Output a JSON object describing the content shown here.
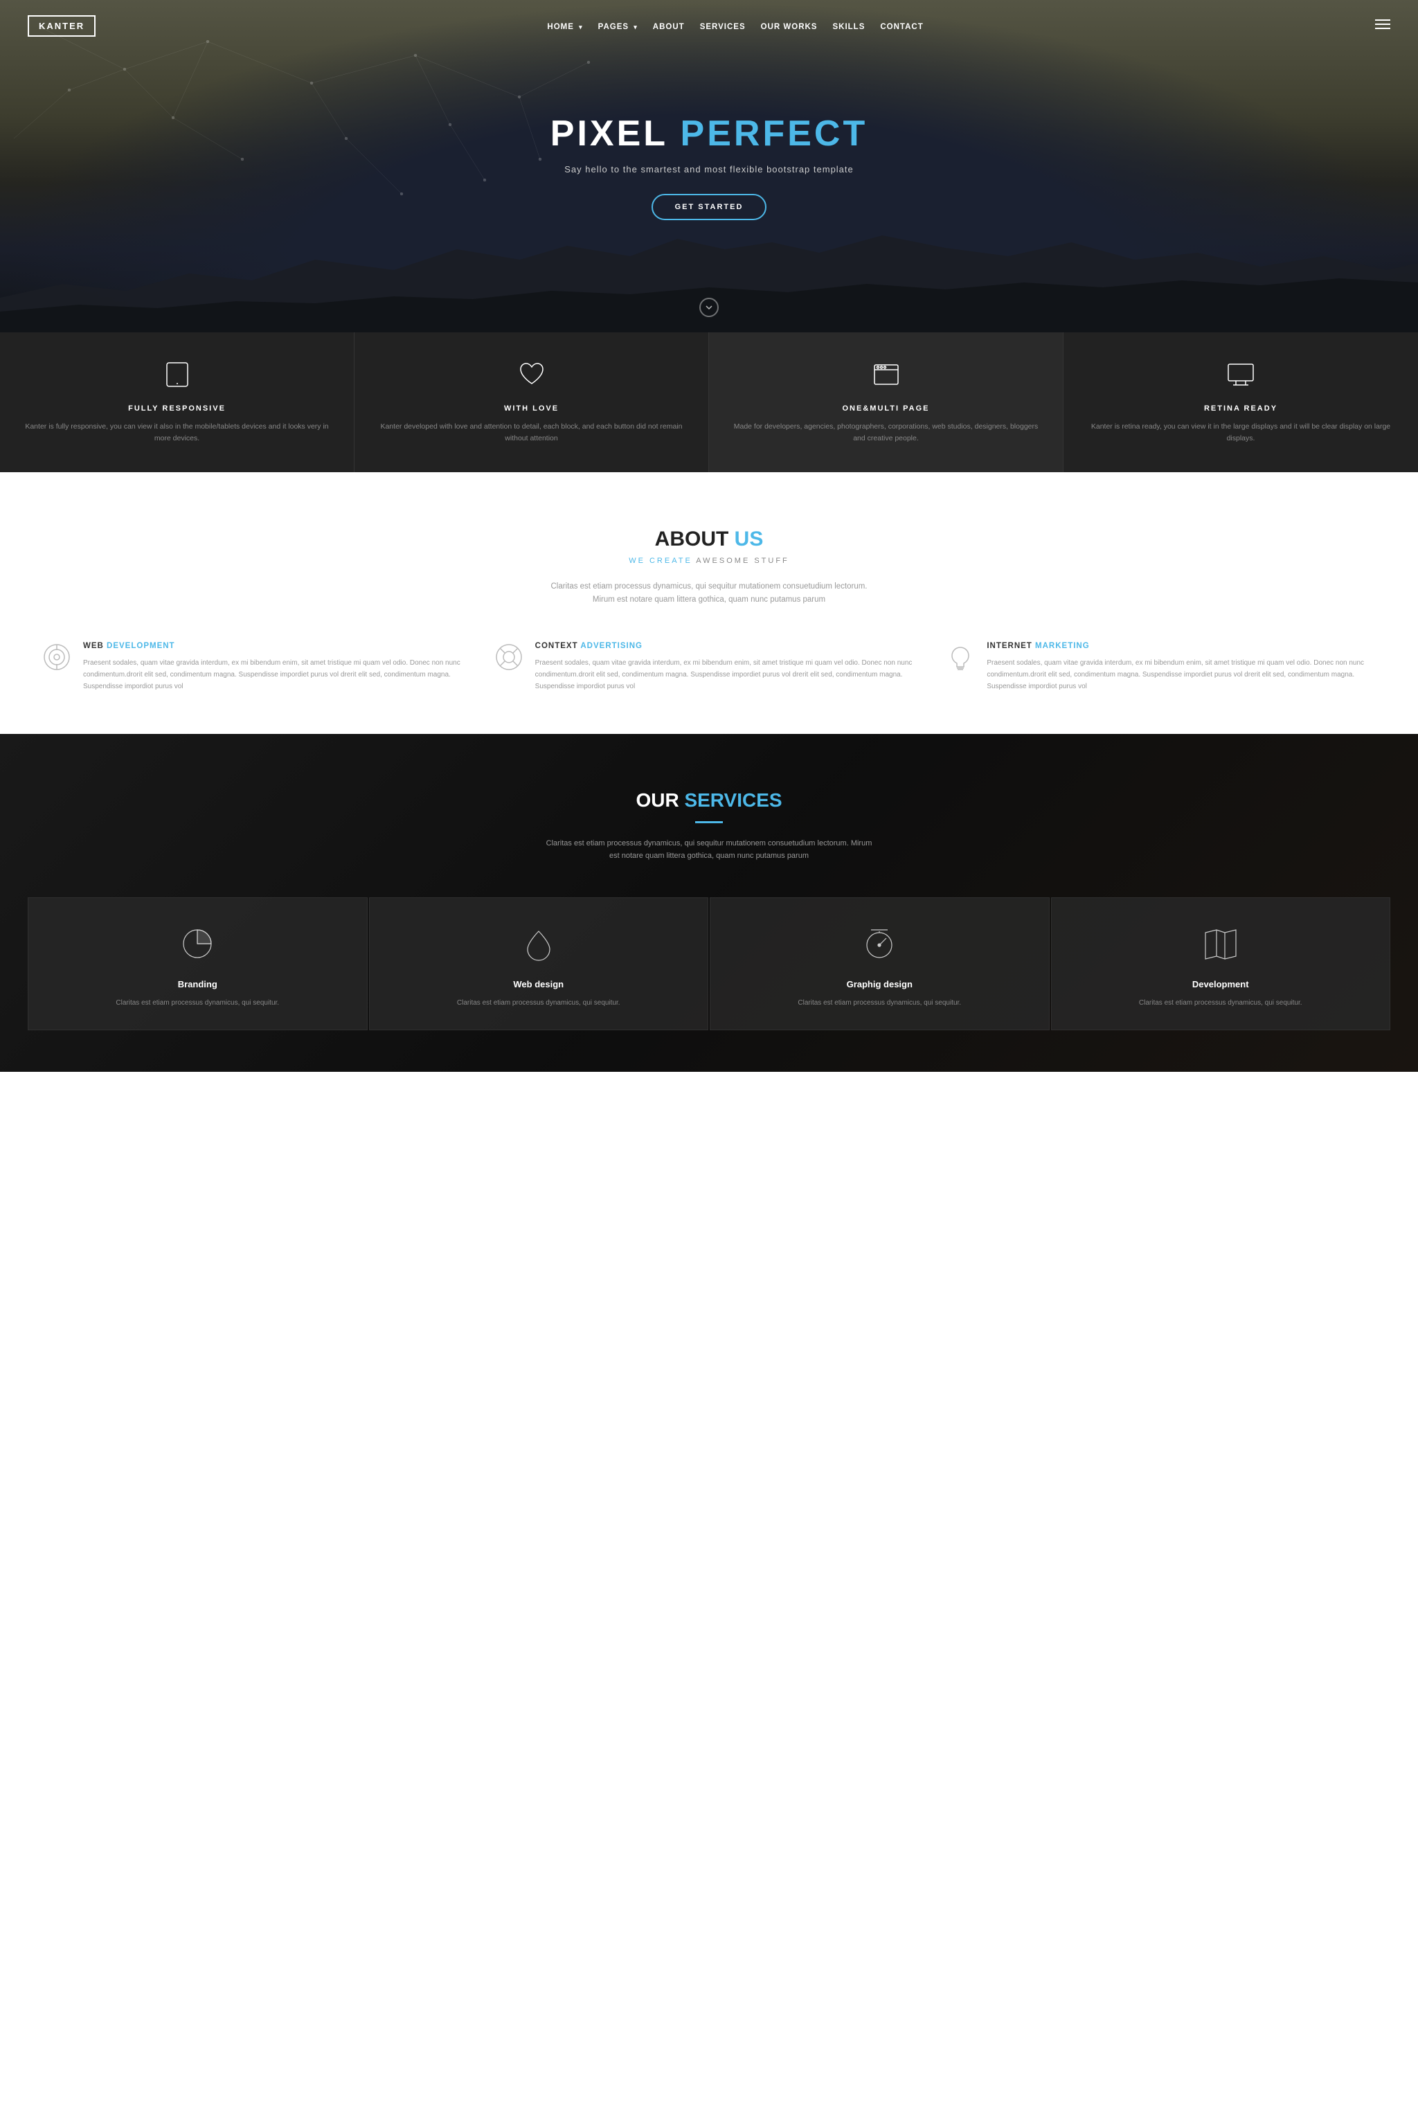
{
  "navbar": {
    "logo": "KANTER",
    "links": [
      {
        "label": "HOME",
        "has_chevron": true
      },
      {
        "label": "PAGES",
        "has_chevron": true
      },
      {
        "label": "ABOUT",
        "has_chevron": false
      },
      {
        "label": "SERVICES",
        "has_chevron": false
      },
      {
        "label": "OUR WORKS",
        "has_chevron": false
      },
      {
        "label": "SKILLS",
        "has_chevron": false
      },
      {
        "label": "CONTACT",
        "has_chevron": false
      }
    ]
  },
  "hero": {
    "title_1": "PIXEL ",
    "title_2": "PERFECT",
    "subtitle": "Say hello to the smartest and most flexible bootstrap template",
    "btn_label": "GET STARTED",
    "scroll_icon": "⌄"
  },
  "features": [
    {
      "icon": "tablet",
      "title": "FULLY RESPONSIVE",
      "desc": "Kanter is fully responsive, you can view it also in the mobile/tablets devices and it looks very in more devices."
    },
    {
      "icon": "heart",
      "title": "WITH LOVE",
      "desc": "Kanter developed with love and attention to detail, each block, and each button did not remain without attention"
    },
    {
      "icon": "browser",
      "title": "ONE&MULTI PAGE",
      "desc": "Made for developers, agencies, photographers, corporations, web studios, designers, bloggers and creative people."
    },
    {
      "icon": "monitor",
      "title": "RETINA READY",
      "desc": "Kanter is retina ready, you can view it in the large displays and it will be clear display on large displays."
    }
  ],
  "about": {
    "title_1": "ABOUT ",
    "title_2": "US",
    "subtitle_1": "WE CREATE ",
    "subtitle_2": "AWESOME STUFF",
    "desc": "Claritas est etiam processus dynamicus, qui sequitur mutationem consuetudium lectorum. Mirum est notare quam littera gothica, quam nunc putamus parum",
    "features": [
      {
        "icon": "target",
        "title_1": "WEB ",
        "title_2": "DEVELOPMENT",
        "desc": "Praesent sodales, quam vitae gravida interdum, ex mi bibendum enim, sit amet tristique mi quam vel odio. Donec non nunc condimentum.drorit elit sed, condimentum magna. Suspendisse impordiet purus vol drerit elit sed, condimentum magna. Suspendisse impordiot purus vol"
      },
      {
        "icon": "lifesaver",
        "title_1": "CONTEXT ",
        "title_2": "ADVERTISING",
        "desc": "Praesent sodales, quam vitae gravida interdum, ex mi bibendum enim, sit amet tristique mi quam vel odio. Donec non nunc condimentum.drorit elit sed, condimentum magna. Suspendisse impordiet purus vol drerit elit sed, condimentum magna. Suspendisse impordiot purus vol"
      },
      {
        "icon": "bulb",
        "title_1": "INTERNET ",
        "title_2": "MARKETING",
        "desc": "Praesent sodales, quam vitae gravida interdum, ex mi bibendum enim, sit amet tristique mi quam vel odio. Donec non nunc condimentum.drorit elit sed, condimentum magna. Suspendisse impordiet purus vol drerit elit sed, condimentum magna. Suspendisse impordiot purus vol"
      }
    ]
  },
  "services": {
    "title_1": "OUR ",
    "title_2": "SERVICES",
    "desc": "Claritas est etiam processus dynamicus, qui sequitur mutationem consuetudium lectorum. Mirum est notare quam littera gothica, quam nunc putamus parum",
    "cards": [
      {
        "icon": "pie",
        "title": "Branding",
        "desc": "Claritas est etiam processus dynamicus, qui sequitur."
      },
      {
        "icon": "drop",
        "title": "Web design",
        "desc": "Claritas est etiam processus dynamicus, qui sequitur."
      },
      {
        "icon": "timer",
        "title": "Graphig design",
        "desc": "Claritas est etiam processus dynamicus, qui sequitur."
      },
      {
        "icon": "map",
        "title": "Development",
        "desc": "Claritas est etiam processus dynamicus, qui sequitur."
      }
    ]
  }
}
